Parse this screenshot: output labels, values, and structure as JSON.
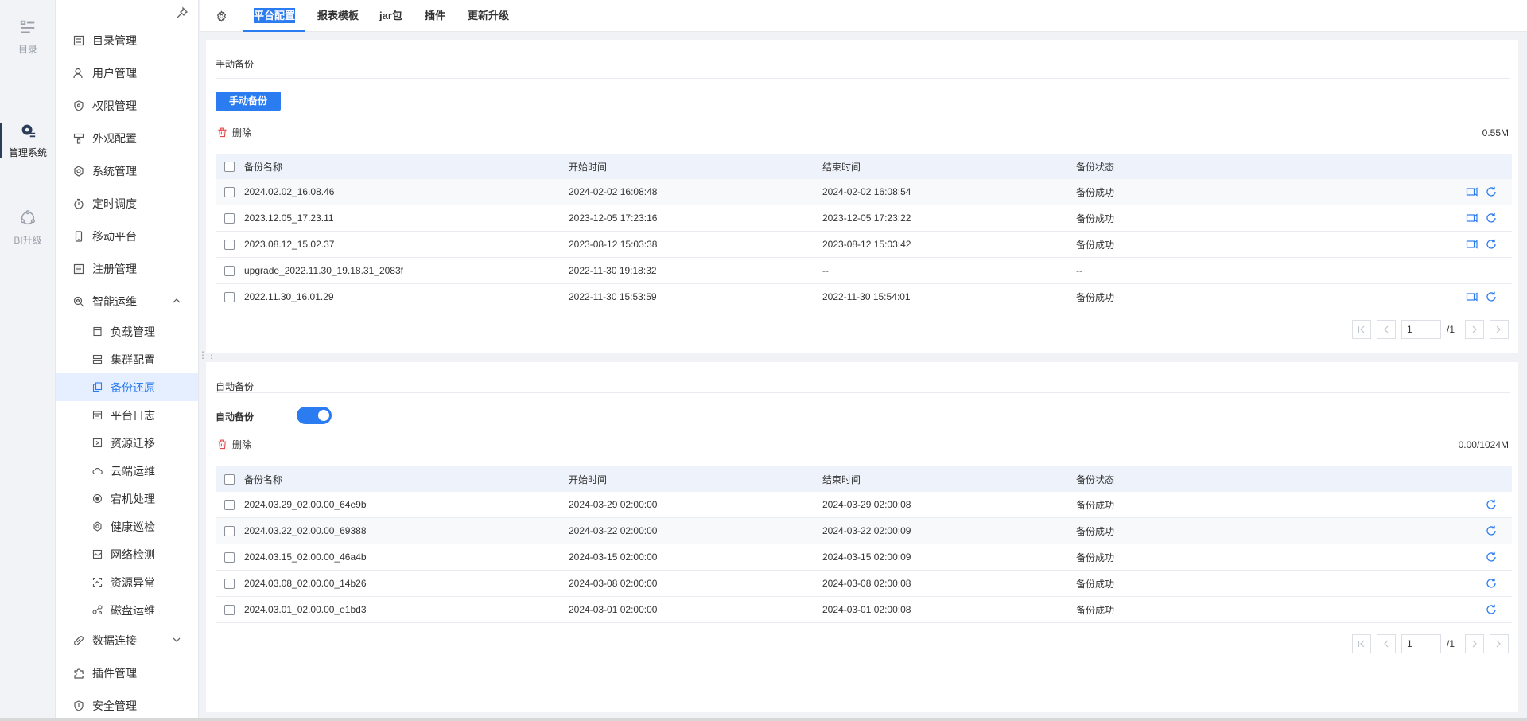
{
  "rail": [
    {
      "label": "目录",
      "icon": "catalog-icon",
      "active": false
    },
    {
      "label": "管理系统",
      "icon": "manage-gear-icon",
      "active": true
    },
    {
      "label": "BI升级",
      "icon": "bi-upgrade-icon",
      "active": false
    }
  ],
  "sidebar": {
    "items": [
      {
        "label": "目录管理",
        "icon": "catalog-manage-icon"
      },
      {
        "label": "用户管理",
        "icon": "user-icon"
      },
      {
        "label": "权限管理",
        "icon": "shield-icon"
      },
      {
        "label": "外观配置",
        "icon": "brush-icon"
      },
      {
        "label": "系统管理",
        "icon": "gear-icon"
      },
      {
        "label": "定时调度",
        "icon": "timer-icon"
      },
      {
        "label": "移动平台",
        "icon": "mobile-icon"
      },
      {
        "label": "注册管理",
        "icon": "register-icon"
      },
      {
        "label": "智能运维",
        "icon": "smart-ops-icon"
      }
    ],
    "sub_items": [
      {
        "label": "负载管理",
        "icon": "load-icon"
      },
      {
        "label": "集群配置",
        "icon": "cluster-icon"
      },
      {
        "label": "备份还原",
        "icon": "backup-icon"
      },
      {
        "label": "平台日志",
        "icon": "log-icon"
      },
      {
        "label": "资源迁移",
        "icon": "migrate-icon"
      },
      {
        "label": "云端运维",
        "icon": "cloud-icon"
      },
      {
        "label": "宕机处理",
        "icon": "crash-icon"
      },
      {
        "label": "健康巡检",
        "icon": "health-icon"
      },
      {
        "label": "网络检测",
        "icon": "network-icon"
      },
      {
        "label": "资源异常",
        "icon": "resource-error-icon"
      },
      {
        "label": "磁盘运维",
        "icon": "disk-icon"
      }
    ],
    "bottom_items": [
      {
        "label": "数据连接",
        "icon": "link-icon"
      },
      {
        "label": "插件管理",
        "icon": "plugin-icon"
      },
      {
        "label": "安全管理",
        "icon": "security-icon"
      }
    ]
  },
  "tabs": [
    "平台配置",
    "报表模板",
    "jar包",
    "插件",
    "更新升级"
  ],
  "manual": {
    "title": "手动备份",
    "button": "手动备份",
    "delete": "删除",
    "size": "0.55M",
    "headers": [
      "备份名称",
      "开始时间",
      "结束时间",
      "备份状态"
    ],
    "rows": [
      {
        "name": "2024.02.02_16.08.46",
        "start": "2024-02-02 16:08:48",
        "end": "2024-02-02 16:08:54",
        "status": "备份成功",
        "actions": true
      },
      {
        "name": "2023.12.05_17.23.11",
        "start": "2023-12-05 17:23:16",
        "end": "2023-12-05 17:23:22",
        "status": "备份成功",
        "actions": true
      },
      {
        "name": "2023.08.12_15.02.37",
        "start": "2023-08-12 15:03:38",
        "end": "2023-08-12 15:03:42",
        "status": "备份成功",
        "actions": true
      },
      {
        "name": "upgrade_2022.11.30_19.18.31_2083f",
        "start": "2022-11-30 19:18:32",
        "end": "--",
        "status": "--",
        "actions": false
      },
      {
        "name": "2022.11.30_16.01.29",
        "start": "2022-11-30 15:53:59",
        "end": "2022-11-30 15:54:01",
        "status": "备份成功",
        "actions": true
      }
    ],
    "page": "1",
    "total": "/1"
  },
  "auto": {
    "title": "自动备份",
    "label": "自动备份",
    "enabled": true,
    "delete": "删除",
    "size": "0.00/1024M",
    "headers": [
      "备份名称",
      "开始时间",
      "结束时间",
      "备份状态"
    ],
    "rows": [
      {
        "name": "2024.03.29_02.00.00_64e9b",
        "start": "2024-03-29 02:00:00",
        "end": "2024-03-29 02:00:08",
        "status": "备份成功"
      },
      {
        "name": "2024.03.22_02.00.00_69388",
        "start": "2024-03-22 02:00:00",
        "end": "2024-03-22 02:00:09",
        "status": "备份成功"
      },
      {
        "name": "2024.03.15_02.00.00_46a4b",
        "start": "2024-03-15 02:00:00",
        "end": "2024-03-15 02:00:09",
        "status": "备份成功"
      },
      {
        "name": "2024.03.08_02.00.00_14b26",
        "start": "2024-03-08 02:00:00",
        "end": "2024-03-08 02:00:08",
        "status": "备份成功"
      },
      {
        "name": "2024.03.01_02.00.00_e1bd3",
        "start": "2024-03-01 02:00:00",
        "end": "2024-03-01 02:00:08",
        "status": "备份成功"
      }
    ],
    "page": "1",
    "total": "/1"
  },
  "colors": {
    "accent": "#2b7bf1",
    "danger": "#e5484d"
  }
}
